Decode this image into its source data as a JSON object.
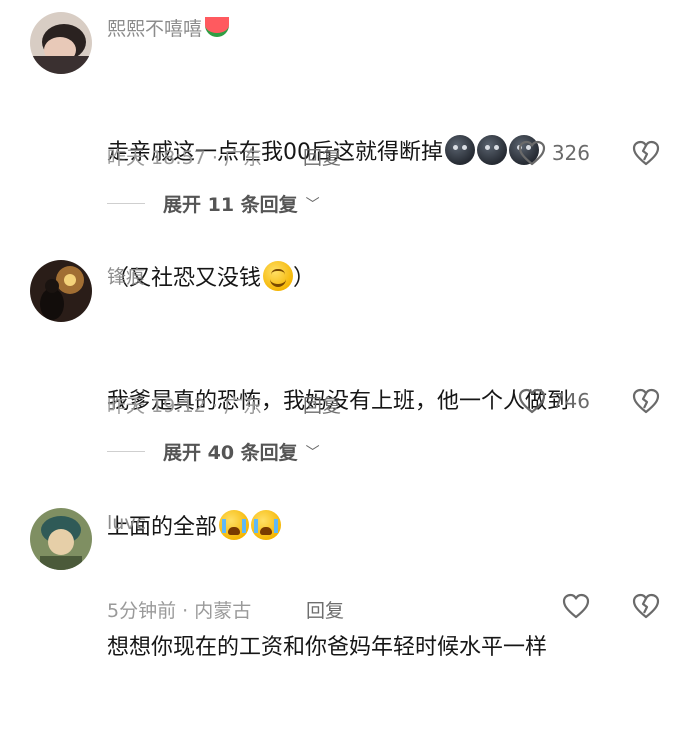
{
  "comments": [
    {
      "username": "熙熙不嘻嘻",
      "username_emoji": "watermelon",
      "text_line1": "走亲戚这一点在我00后这就得断掉",
      "text_line1_emojis": [
        "dark-face",
        "dark-face",
        "dark-face"
      ],
      "text_line2": "（又社恐又没钱",
      "text_line2_tail": "）",
      "text_line2_emoji": "smile-face",
      "time_location": "昨天 18:57 · 广东",
      "reply_label": "回复",
      "likes": "326",
      "expand_label": "展开 11 条回复"
    },
    {
      "username": "锋痕",
      "text_line1": "我爹是真的恐怖，我妈没有上班，他一个人做到",
      "text_line2": "上面的全部",
      "text_line2_emojis": [
        "crying-face",
        "crying-face"
      ],
      "time_location": "昨天 19:12 · 广东",
      "reply_label": "回复",
      "likes": "746",
      "expand_label": "展开 40 条回复"
    },
    {
      "username": "luvc",
      "text_line1": "想想你现在的工资和你爸妈年轻时候水平一样",
      "time_location": "5分钟前 · 内蒙古",
      "reply_label": "回复",
      "likes": ""
    }
  ],
  "icons": {
    "like": "heart-outline-icon",
    "dislike": "broken-heart-outline-icon",
    "expand": "chevron-down-icon"
  },
  "colors": {
    "username": "#8c8c8c",
    "body_text": "#161616",
    "meta": "#9a9a9a",
    "icon": "#6a6a6a"
  }
}
